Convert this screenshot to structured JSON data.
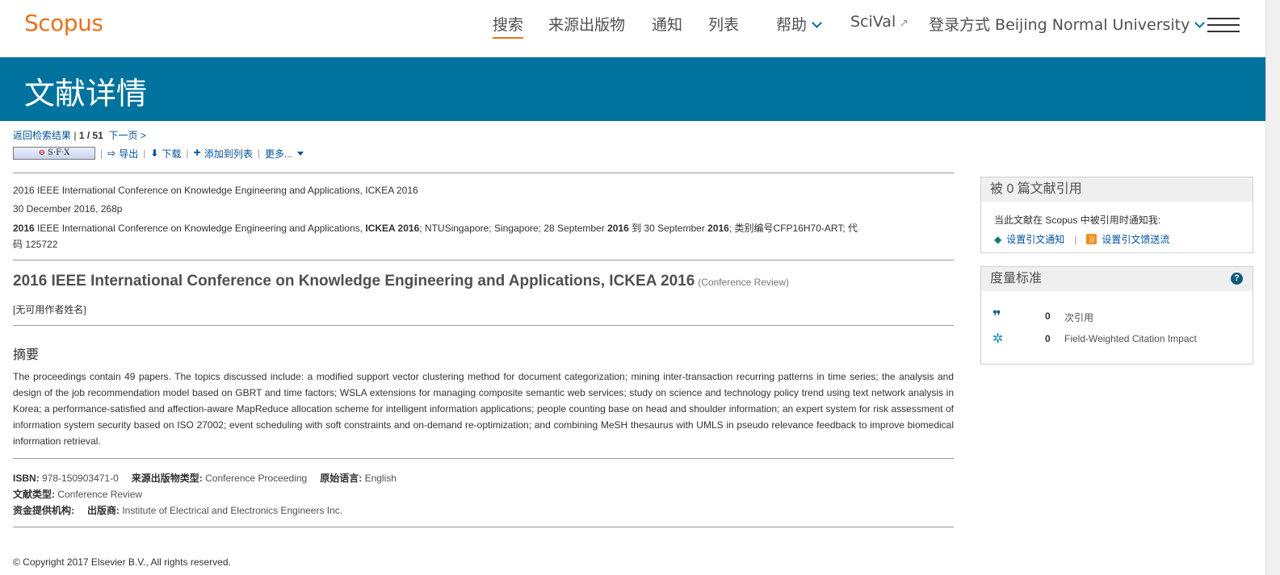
{
  "header": {
    "logo": "Scopus",
    "nav": [
      "搜索",
      "来源出版物",
      "通知",
      "列表"
    ],
    "help": "帮助",
    "scival": "SciVal",
    "scival_icon": "external-link-icon",
    "login": "登录方式 Beijing Normal University",
    "menu_icon": "hamburger-icon",
    "accent": "#e9711c"
  },
  "banner": {
    "title": "文献详情",
    "color": "#00729e"
  },
  "navigation": {
    "back": "返回检索结果",
    "separator": "|",
    "position": "1 / 51",
    "next": "下一页 >"
  },
  "toolbar": {
    "sfx": "S·F·X",
    "export": "导出",
    "download": "下载",
    "add_to_list": "添加到列表",
    "more": "更多..."
  },
  "source": {
    "line1": "2016 IEEE International Conference on Knowledge Engineering and Applications, ICKEA 2016",
    "line2": "30 December 2016, 268p",
    "line3a_bold": "2016",
    "line3b": " IEEE International Conference on Knowledge Engineering and Applications, ",
    "line3c_bold": "ICKEA 2016",
    "line3d": "; NTUSingapore; Singapore; 28 September ",
    "line3e_bold": "2016",
    "line3f": " 到 30 September ",
    "line3g_bold": "2016",
    "line3h": "; 类别编号CFP16H70-ART; 代",
    "line4": "码 125722"
  },
  "document": {
    "title": "2016 IEEE International Conference on Knowledge Engineering and Applications, ICKEA 2016",
    "doc_type_label": "(Conference Review)",
    "authors": "[无可用作者姓名]"
  },
  "abstract": {
    "heading": "摘要",
    "text": "The proceedings contain 49 papers. The topics discussed include: a modified support vector clustering method for document categorization; mining inter-transaction recurring patterns in time series; the analysis and design of the job recommendation model based on GBRT and time factors; WSLA extensions for managing composite semantic web services; study on science and technology policy trend using text network analysis in Korea; a performance-satisfied and affection-aware MapReduce allocation scheme for intelligent information applications; people counting base on head and shoulder information; an expert system for risk assessment of information system security based on ISO 27002; event scheduling with soft constraints and on-demand re-optimization; and combining MeSH thesaurus with UMLS in pseudo relevance feedback to improve biomedical information retrieval."
  },
  "metadata": {
    "isbn_label": "ISBN:",
    "isbn": "978-150903471-0",
    "source_type_label": "来源出版物类型:",
    "source_type": "Conference Proceeding",
    "language_label": "原始语言:",
    "language": "English",
    "doc_type_label": "文献类型:",
    "doc_type": "Conference Review",
    "funding_label": "资金提供机构:",
    "publisher_label": "出版商:",
    "publisher": "Institute of Electrical and Electronics Engineers Inc."
  },
  "footer": {
    "copyright": "© Copyright 2017 Elsevier B.V., All rights reserved."
  },
  "citations_box": {
    "title": "被 0 篇文献引用",
    "notify": "当此文献在 Scopus 中被引用时通知我:",
    "set_alert": "设置引文通知",
    "set_feed": "设置引文馈送流",
    "separator": "|"
  },
  "metrics_box": {
    "title": "度量标准",
    "help": "?",
    "citations_value": "0",
    "citations_label": "次引用",
    "fwci_value": "0",
    "fwci_label": "Field-Weighted Citation Impact"
  }
}
